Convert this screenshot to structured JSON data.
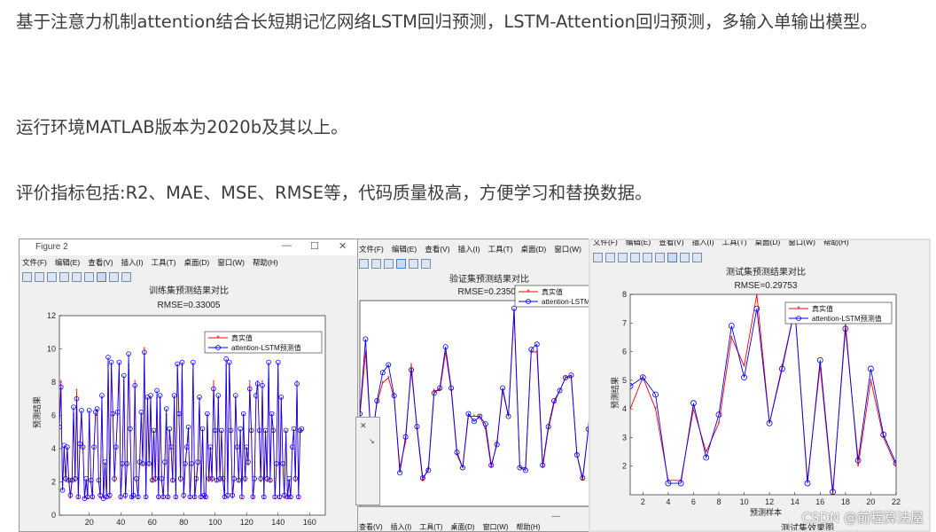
{
  "article": {
    "p1": "基于注意力机制attention结合长短期记忆网络LSTM回归预测，LSTM-Attention回归预测，多输入单输出模型。",
    "p2": "运行环境MATLAB版本为2020b及其以上。",
    "p3": "评价指标包括:R2、MAE、MSE、RMSE等，代码质量极高，方便学习和替换数据。"
  },
  "menu_items": [
    "文件(F)",
    "编辑(E)",
    "查看(V)",
    "插入(I)",
    "工具(T)",
    "桌面(D)",
    "窗口(W)",
    "帮助(H)"
  ],
  "win1": {
    "title": "Figure 2",
    "plot_title": "训练集预测结果对比",
    "rmse": "RMSE=0.33005",
    "ylabel": "预测结果",
    "legend": [
      "真实值",
      "attention-LSTM预测值"
    ]
  },
  "win2": {
    "plot_title": "验证集预测结果对比",
    "rmse": "RMSE=0.23505",
    "legend": [
      "真实值",
      "attention-LSTM"
    ]
  },
  "win3": {
    "plot_title": "测试集预测结果对比",
    "rmse": "RMSE=0.29753",
    "ylabel": "预测结果",
    "xlabel": "预测样本",
    "legend": [
      "真实值",
      "attention-LSTM预测值"
    ],
    "bottom_label": "测试集效果图"
  },
  "bottom_menu": [
    "查看(V)",
    "插入(I)",
    "工具(T)",
    "桌面(D)",
    "窗口(W)",
    "帮助(H)"
  ],
  "watermark": "CSDN @前程算法屋",
  "colors": {
    "true": "#ff0000",
    "pred": "#0000ff"
  },
  "chart_data": [
    {
      "type": "line",
      "title": "训练集预测结果对比 RMSE=0.33005",
      "xlabel": "",
      "ylabel": "预测结果",
      "xlim": [
        1,
        170
      ],
      "ylim": [
        0,
        12
      ],
      "xticks": [
        20,
        40,
        60,
        80,
        100,
        120,
        140,
        160
      ],
      "yticks": [
        0,
        2,
        4,
        6,
        8,
        10,
        12
      ],
      "series": [
        {
          "name": "真实值",
          "values": [
            5.5,
            8,
            1.5,
            4,
            2,
            4,
            2,
            1,
            2,
            6,
            2,
            7.5,
            1,
            4,
            6,
            4,
            1,
            2,
            1,
            6,
            2,
            1,
            4,
            6,
            6,
            2,
            1,
            7,
            1,
            3,
            1,
            9,
            1,
            9,
            6,
            2,
            4,
            6,
            9,
            1,
            3,
            8,
            1,
            3,
            9,
            5,
            1,
            1,
            8,
            2,
            1,
            3,
            6,
            3,
            10,
            1,
            7,
            3,
            7,
            2,
            5,
            2,
            7,
            1,
            7,
            2,
            1,
            3,
            6,
            1,
            5,
            4,
            2,
            7,
            1,
            9,
            6,
            2,
            9,
            1,
            3,
            4,
            5,
            1,
            3,
            9,
            1,
            2,
            3,
            7,
            1,
            5,
            1,
            1,
            6,
            2,
            4,
            2,
            8,
            5,
            2,
            7,
            2,
            5,
            2,
            1,
            9,
            1,
            9,
            5,
            1,
            2,
            7,
            4,
            2,
            5,
            1,
            6,
            2,
            4,
            3,
            8,
            5,
            1,
            2,
            7,
            8,
            5,
            2,
            8,
            1,
            5,
            2,
            9,
            2,
            6,
            5,
            1,
            3,
            9,
            1,
            7,
            3,
            1,
            5,
            1,
            2,
            1,
            4,
            5,
            2,
            8,
            1,
            5,
            5
          ]
        },
        {
          "name": "attention-LSTM预测值",
          "values": [
            5.3,
            7.7,
            1.5,
            4.2,
            2.2,
            4.1,
            2.1,
            1.2,
            2.1,
            6.5,
            2.2,
            7,
            1.1,
            4.3,
            6.3,
            4.1,
            1,
            2.2,
            1.1,
            6.3,
            2.1,
            1.1,
            4.1,
            6.2,
            6.4,
            2.1,
            1.2,
            7.2,
            1,
            3.2,
            1.1,
            9.5,
            1.2,
            9.2,
            6.1,
            2.2,
            4.1,
            6.2,
            9.2,
            1.1,
            3.1,
            8.4,
            1.2,
            3.1,
            9.7,
            5.2,
            1.1,
            1.2,
            7.8,
            2.2,
            1.1,
            3.2,
            6.2,
            3.1,
            9.8,
            1.1,
            7.1,
            3.1,
            7.2,
            2.1,
            5.1,
            2.2,
            7.5,
            1.1,
            7.2,
            2.2,
            1.1,
            3.2,
            6.4,
            1.1,
            5.2,
            4.1,
            2.1,
            7.2,
            1.1,
            9.1,
            6.1,
            2.2,
            9.2,
            1.2,
            3.1,
            4.1,
            5.3,
            1.1,
            3.1,
            9.2,
            1.1,
            2.2,
            3.2,
            7.1,
            1.1,
            5.2,
            1.2,
            1.1,
            6.1,
            2.2,
            4.1,
            2.2,
            7.6,
            5.1,
            2.1,
            7.2,
            2.2,
            5.1,
            2.2,
            1.1,
            9.4,
            1.2,
            9.2,
            5.1,
            1.2,
            2.2,
            7.2,
            4.1,
            2.1,
            5.2,
            1.1,
            6.1,
            2.2,
            4.1,
            3.2,
            7.6,
            5.1,
            1.1,
            2.2,
            7.2,
            7.9,
            5.1,
            2.2,
            7.8,
            1.1,
            5.1,
            2.2,
            9.2,
            2.1,
            6.1,
            5.1,
            1.1,
            3.1,
            9.2,
            1.1,
            7.1,
            3.1,
            1.2,
            5.1,
            1.1,
            2.2,
            1.1,
            4.1,
            5.2,
            2.2,
            7.9,
            1.1,
            5.1,
            5.2
          ]
        }
      ]
    },
    {
      "type": "line",
      "title": "验证集预测结果对比 RMSE=0.23505",
      "ylim": [
        1,
        9
      ],
      "series": [
        {
          "name": "真实值",
          "values": [
            4.5,
            7,
            3.5,
            5,
            5.8,
            6,
            5.2,
            2.5,
            3.5,
            6.5,
            4,
            2,
            2.5,
            5.5,
            5.5,
            7,
            5.5,
            3,
            2.5,
            4.5,
            4.5,
            4.5,
            4,
            2.5,
            3.5,
            5.5,
            4.5,
            8.5,
            2.5,
            2.5,
            7,
            7,
            2.5,
            4,
            5,
            5.5,
            6,
            6,
            3,
            2,
            4,
            7,
            6,
            5.5
          ]
        },
        {
          "name": "attention-LSTM",
          "values": [
            4.6,
            7.5,
            3.4,
            5.1,
            6.2,
            6.5,
            5.3,
            2.3,
            3.7,
            6.3,
            4.1,
            2.1,
            2.4,
            5.4,
            5.6,
            7.2,
            5.6,
            3.1,
            2.5,
            4.6,
            4.3,
            4.5,
            4.2,
            2.6,
            3.4,
            5.6,
            4.5,
            8.7,
            2.5,
            2.4,
            7.1,
            7.3,
            2.6,
            4.1,
            5.1,
            5.5,
            6,
            6.1,
            3,
            2.1,
            4,
            7.1,
            6.2,
            5.6
          ]
        }
      ]
    },
    {
      "type": "line",
      "title": "测试集预测结果对比 RMSE=0.29753",
      "xlabel": "预测样本",
      "ylabel": "预测结果",
      "xlim": [
        1,
        22
      ],
      "ylim": [
        1,
        8
      ],
      "xticks": [
        2,
        4,
        6,
        8,
        10,
        12,
        14,
        16,
        18,
        20,
        22
      ],
      "yticks": [
        2,
        3,
        4,
        5,
        6,
        7,
        8
      ],
      "x": [
        1,
        2,
        3,
        4,
        5,
        6,
        7,
        8,
        9,
        10,
        11,
        12,
        13,
        14,
        15,
        16,
        17,
        18,
        19,
        20,
        21,
        22
      ],
      "series": [
        {
          "name": "真实值",
          "values": [
            4,
            5.1,
            4,
            1.5,
            1.5,
            4,
            2.5,
            3.5,
            6.5,
            5.5,
            8,
            3.5,
            5.5,
            7.5,
            1.5,
            5.5,
            1,
            7,
            2,
            5,
            3,
            2
          ]
        },
        {
          "name": "attention-LSTM预测值",
          "values": [
            4.8,
            5.1,
            4.5,
            1.4,
            1.4,
            4.2,
            2.3,
            3.8,
            6.9,
            5.1,
            7.5,
            3.5,
            5.4,
            7.5,
            1.4,
            5.7,
            1.1,
            6.8,
            2.2,
            5.4,
            3.1,
            2.1
          ]
        }
      ]
    }
  ]
}
